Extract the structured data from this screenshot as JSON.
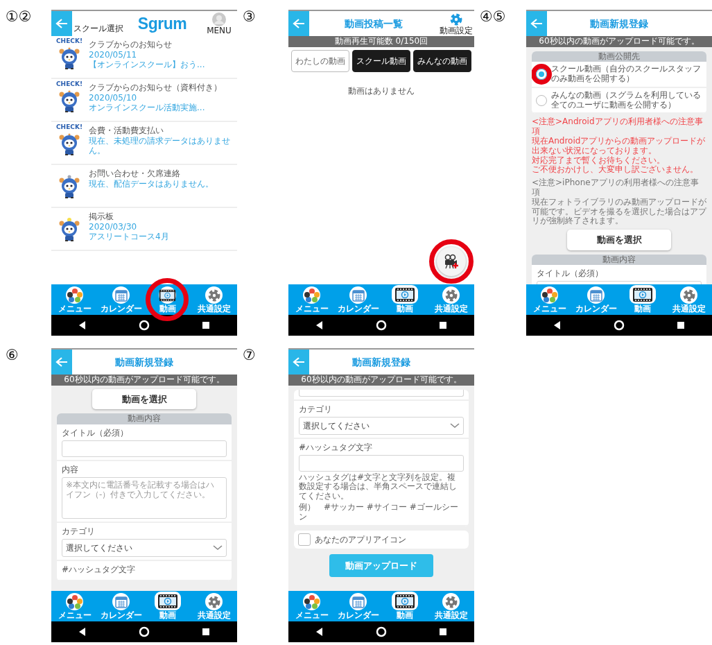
{
  "panels": [
    {
      "step": "①②",
      "header": {
        "kind": "logo",
        "text": "Sgrum",
        "back_label": "スクール選択",
        "right": {
          "kind": "avatar",
          "label": "MENU"
        }
      },
      "blocks": [
        {
          "kind": "notices",
          "items": [
            {
              "kind": "check",
              "caption": "CHECK!",
              "title": "クラブからのお知らせ",
              "date": "2020/05/11",
              "summary": "【オンラインスクール】おう..."
            },
            {
              "kind": "check",
              "caption": "CHECK!",
              "title": "クラブからのお知らせ（資料付き）",
              "date": "2020/05/10",
              "summary": "オンラインスクール活動実施..."
            },
            {
              "kind": "check",
              "caption": "CHECK!",
              "title": "会費・活動費支払い",
              "summary": "現在、未処理の請求データはありません。"
            },
            {
              "kind": "question",
              "title": "お問い合わせ・欠席連絡",
              "summary": "現在、配信データはありません。"
            },
            {
              "kind": "bulb",
              "title": "掲示板",
              "date": "2020/03/30",
              "summary": "アスリートコース4月"
            }
          ]
        }
      ],
      "nav": [
        {
          "label": "メニュー",
          "selected": false,
          "highlight": false
        },
        {
          "label": "カレンダー",
          "selected": false,
          "highlight": false
        },
        {
          "label": "動画",
          "selected": false,
          "highlight": true
        },
        {
          "label": "共通設定",
          "selected": false,
          "highlight": false
        }
      ]
    },
    {
      "step": "③",
      "header": {
        "kind": "title",
        "text": "動画投稿一覧",
        "right": {
          "kind": "gear",
          "label": "動画設定"
        }
      },
      "banner": "動画再生可能数 0/150回",
      "blocks": [
        {
          "kind": "tabs",
          "items": [
            {
              "label": "わたしの動画",
              "selected": true
            },
            {
              "label": "スクール動画",
              "selected": false
            },
            {
              "label": "みんなの動画",
              "selected": false
            }
          ]
        },
        {
          "kind": "empty",
          "text": "動画はありません"
        },
        {
          "kind": "fab",
          "highlight": true
        }
      ],
      "nav": [
        {
          "label": "メニュー",
          "selected": false,
          "highlight": false
        },
        {
          "label": "カレンダー",
          "selected": false,
          "highlight": false
        },
        {
          "label": "動画",
          "selected": true,
          "highlight": false
        },
        {
          "label": "共通設定",
          "selected": false,
          "highlight": false
        }
      ]
    },
    {
      "step": "④⑤",
      "header": {
        "kind": "title",
        "text": "動画新規登録"
      },
      "banner": "60秒以内の動画がアップロード可能です。",
      "blocks": [
        {
          "kind": "section",
          "title": "動画公開先",
          "items": [
            {
              "kind": "radio",
              "label": "スクール動画（自分のスクールスタッフのみ動画を公開する）",
              "selected": true,
              "highlight": true
            },
            {
              "kind": "radio",
              "label": "みんなの動画（スグラムを利用している全てのユーザに動画を公開する）",
              "selected": false,
              "highlight": false
            }
          ]
        },
        {
          "kind": "warning_notice",
          "lines": [
            "<注意>Androidアプリの利用者様への注意事項",
            "現在Androidアプリからの動画アップロードが出来ない状況になっております。",
            "対応完了まで暫くお待ちください。",
            "ご不便おかけし、大変申し訳ございません。"
          ]
        },
        {
          "kind": "info_notice",
          "lines": [
            "<注意>iPhoneアプリの利用者様への注意事項",
            "現在フォトライブラリのみ動画アップロードが可能です。ビデオを撮るを選択した場合はアプリが強制終了されます。"
          ]
        },
        {
          "kind": "plain_button",
          "label": "動画を選択"
        },
        {
          "kind": "section",
          "title": "動画内容",
          "items": [
            {
              "kind": "text_field",
              "label": "タイトル（必須）"
            }
          ]
        }
      ],
      "nav": [
        {
          "label": "メニュー",
          "selected": false,
          "highlight": false
        },
        {
          "label": "カレンダー",
          "selected": false,
          "highlight": false
        },
        {
          "label": "動画",
          "selected": true,
          "highlight": false
        },
        {
          "label": "共通設定",
          "selected": false,
          "highlight": false
        }
      ]
    },
    {
      "step": "⑥",
      "header": {
        "kind": "title",
        "text": "動画新規登録"
      },
      "banner": "60秒以内の動画がアップロード可能です。",
      "blocks": [
        {
          "kind": "plain_button",
          "label": "動画を選択"
        },
        {
          "kind": "section",
          "title": "動画内容",
          "items": [
            {
              "kind": "text_field",
              "label": "タイトル（必須）"
            },
            {
              "kind": "textarea_field",
              "label": "内容",
              "placeholder": "※本文内に電話番号を記載する場合はハイフン（-）付きで入力してください。"
            },
            {
              "kind": "select_field",
              "label": "カテゴリ",
              "value": "選択してください"
            },
            {
              "kind": "field_label",
              "label": "#ハッシュタグ文字"
            }
          ]
        }
      ],
      "nav": [
        {
          "label": "メニュー",
          "selected": false,
          "highlight": false
        },
        {
          "label": "カレンダー",
          "selected": false,
          "highlight": false
        },
        {
          "label": "動画",
          "selected": true,
          "highlight": false
        },
        {
          "label": "共通設定",
          "selected": false,
          "highlight": false
        }
      ]
    },
    {
      "step": "⑦",
      "header": {
        "kind": "title",
        "text": "動画新規登録"
      },
      "banner": "60秒以内の動画がアップロード可能です。",
      "blocks": [
        {
          "kind": "section",
          "items": [
            {
              "kind": "textarea_stub"
            },
            {
              "kind": "select_field",
              "label": "カテゴリ",
              "value": "選択してください"
            },
            {
              "kind": "text_field",
              "label": "#ハッシュタグ文字",
              "help": [
                "ハッシュタグは#文字と文字列を設定。複数設定する場合は、半角スペースで連結してください。",
                "例）　#サッカー #サイコー #ゴールシーン"
              ]
            }
          ]
        },
        {
          "kind": "checkbox",
          "label": "あなたのアプリアイコン",
          "checked": false
        },
        {
          "kind": "primary_button",
          "label": "動画アップロード"
        }
      ],
      "nav": [
        {
          "label": "メニュー",
          "selected": false,
          "highlight": false
        },
        {
          "label": "カレンダー",
          "selected": false,
          "highlight": false
        },
        {
          "label": "動画",
          "selected": true,
          "highlight": false
        },
        {
          "label": "共通設定",
          "selected": false,
          "highlight": false
        }
      ]
    }
  ]
}
